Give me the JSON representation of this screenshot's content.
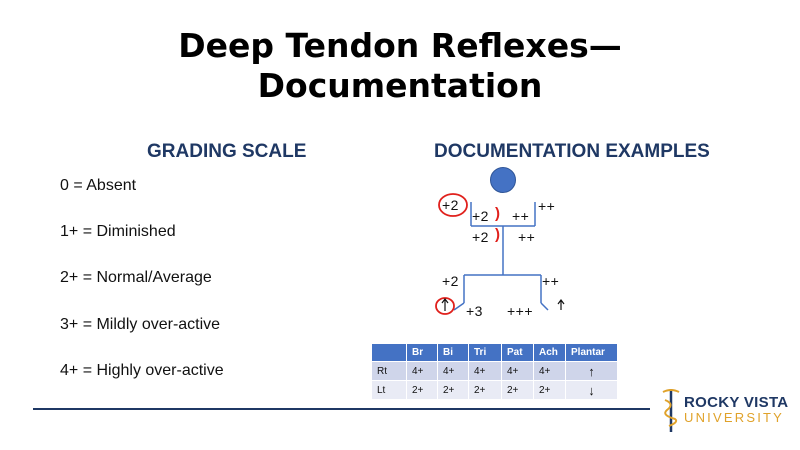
{
  "title": {
    "line1": "Deep Tendon Reflexes—",
    "line2": "Documentation"
  },
  "grading": {
    "heading": "GRADING SCALE",
    "items": [
      "0 = Absent",
      "1+ = Diminished",
      "2+ = Normal/Average",
      "3+ = Mildly over-active",
      "4+ = Highly over-active"
    ]
  },
  "examples": {
    "heading": "DOCUMENTATION EXAMPLES",
    "figure": {
      "left_biceps_circled": "+2",
      "left_biceps": "+2",
      "right_biceps": "++",
      "right_shoulder": "++",
      "left_brachio": "+2",
      "right_brachio": "++",
      "left_knee": "+2",
      "right_knee": "++",
      "left_ankle": "+3",
      "right_ankle": "+++",
      "paren": ")"
    },
    "table": {
      "headers": [
        "",
        "Br",
        "Bi",
        "Tri",
        "Pat",
        "Ach",
        "Plantar"
      ],
      "rows": [
        [
          "Rt",
          "4+",
          "4+",
          "4+",
          "4+",
          "4+",
          "↑"
        ],
        [
          "Lt",
          "2+",
          "2+",
          "2+",
          "2+",
          "2+",
          "↓"
        ]
      ]
    }
  },
  "logo": {
    "line1": "ROCKY VISTA",
    "line2": "UNIVERSITY"
  },
  "colors": {
    "heading": "#1f3864",
    "accent_red": "#e0201c",
    "figure_blue": "#4472c4",
    "logo_gold": "#e0a22a"
  }
}
